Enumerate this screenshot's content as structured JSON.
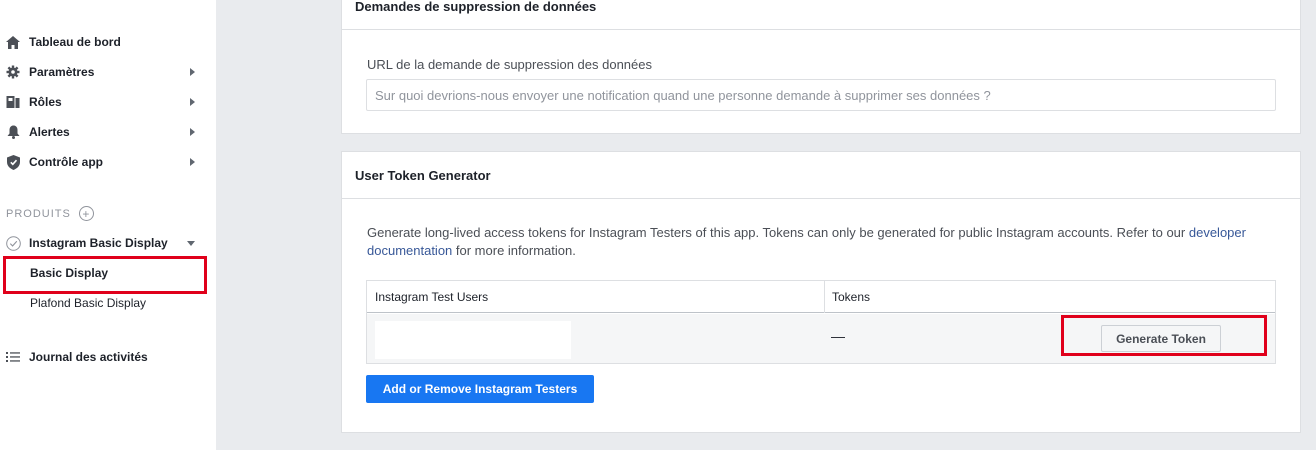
{
  "sidebar": {
    "items": [
      {
        "label": "Tableau de bord",
        "icon": "home-icon"
      },
      {
        "label": "Paramètres",
        "icon": "gear-icon"
      },
      {
        "label": "Rôles",
        "icon": "roles-icon"
      },
      {
        "label": "Alertes",
        "icon": "bell-icon"
      },
      {
        "label": "Contrôle app",
        "icon": "shield-icon"
      }
    ],
    "products_label": "PRODUITS",
    "product": {
      "label": "Instagram Basic Display",
      "subitems": [
        "Basic Display",
        "Plafond Basic Display"
      ]
    },
    "activity_log": "Journal des activités"
  },
  "deletion_card": {
    "title": "Demandes de suppression de données",
    "url_label": "URL de la demande de suppression des données",
    "url_placeholder": "Sur quoi devrions-nous envoyer une notification quand une personne demande à supprimer ses données ?",
    "url_value": ""
  },
  "token_card": {
    "title": "User Token Generator",
    "description_before": "Generate long-lived access tokens for Instagram Testers of this app. Tokens can only be generated for public Instagram accounts. Refer to our ",
    "description_link": "developer documentation",
    "description_after": " for more information.",
    "table": {
      "headers": [
        "Instagram Test Users",
        "Tokens"
      ],
      "rows": [
        {
          "user": "",
          "token": "—",
          "action": "Generate Token"
        }
      ]
    },
    "add_button": "Add or Remove Instagram Testers"
  },
  "colors": {
    "accent": "#1877f2",
    "highlight": "#e0001b",
    "link": "#385898"
  }
}
